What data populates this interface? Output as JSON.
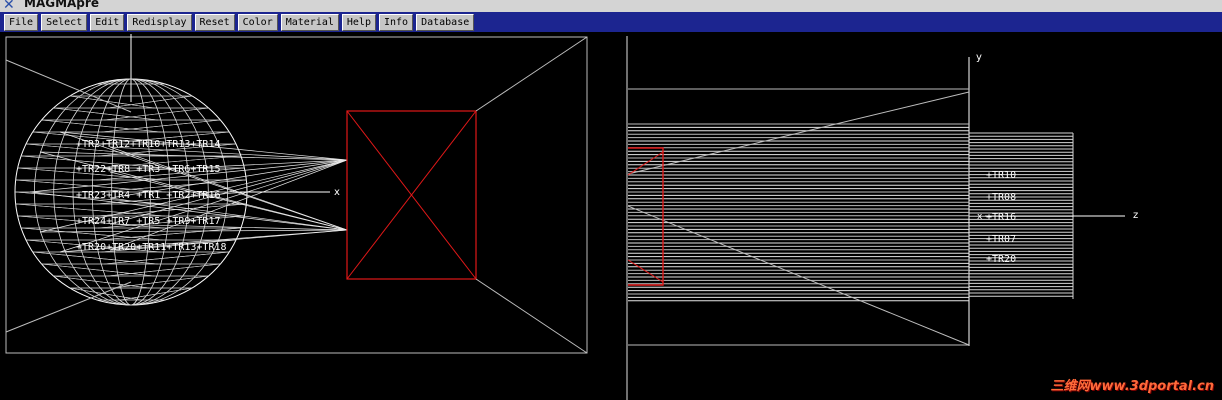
{
  "window": {
    "title": "MAGMApre"
  },
  "menu": [
    "File",
    "Select",
    "Edit",
    "Redisplay",
    "Reset",
    "Color",
    "Material",
    "Help",
    "Info",
    "Database"
  ],
  "front_view": {
    "axis_x": "x",
    "labels": [
      "+TR2+TR12+TR10+TR13+TR14",
      "+TR22+TR8 +TR3 +TR6+TR15",
      "+TR23+TR4 +TR1 +TR2+TR16",
      "+TR24+TR7 +TR5 +TR9+TR17",
      "+TR20+TR20+TR11+TR13+TR18"
    ]
  },
  "side_view": {
    "axis_y": "y",
    "axis_z": "z",
    "axis_x": "x",
    "labels": [
      "+TR10",
      "+TR08",
      "+TR16",
      "+TR07",
      "+TR20"
    ]
  },
  "colors": {
    "background": "#000000",
    "menubar": "#1c2590",
    "wireframe": "#ffffff",
    "mold": "#e01818",
    "watermark": "#ff6a3a"
  },
  "watermark": "三维网www.3dportal.cn"
}
